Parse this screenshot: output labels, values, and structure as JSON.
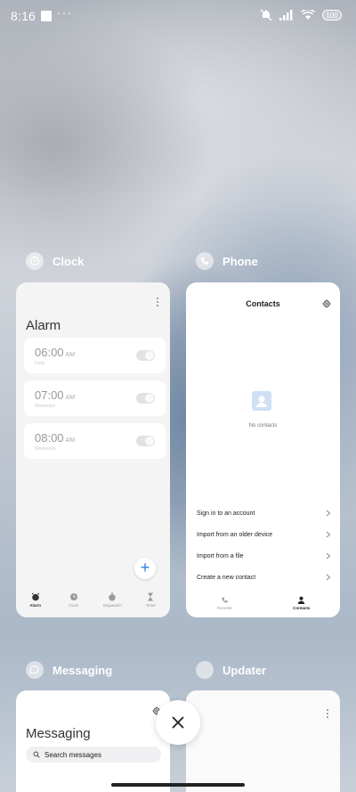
{
  "status_bar": {
    "time": "8:16",
    "dots": "···",
    "battery": "100"
  },
  "clock": {
    "app_name": "Clock",
    "screen_title": "Alarm",
    "alarms": [
      {
        "time": "06:00",
        "ampm": "AM",
        "subtitle": "Daily",
        "enabled": false
      },
      {
        "time": "07:00",
        "ampm": "AM",
        "subtitle": "Weekdays",
        "enabled": false
      },
      {
        "time": "08:00",
        "ampm": "AM",
        "subtitle": "Weekends",
        "enabled": false
      }
    ],
    "fab_label": "+",
    "nav": [
      {
        "label": "Alarm",
        "icon": "alarm-icon",
        "active": true
      },
      {
        "label": "Clock",
        "icon": "clock-icon",
        "active": false
      },
      {
        "label": "Stopwatch",
        "icon": "stopwatch-icon",
        "active": false
      },
      {
        "label": "Timer",
        "icon": "timer-icon",
        "active": false
      }
    ]
  },
  "phone": {
    "app_name": "Phone",
    "screen_title": "Contacts",
    "empty_text": "No contacts",
    "rows": [
      {
        "label": "Sign in to an account"
      },
      {
        "label": "Import from an older device"
      },
      {
        "label": "Import from a file"
      },
      {
        "label": "Create a new contact"
      }
    ],
    "nav": [
      {
        "label": "Recents",
        "icon": "phone-icon",
        "active": false
      },
      {
        "label": "Contacts",
        "icon": "person-icon",
        "active": true
      }
    ]
  },
  "messaging": {
    "app_name": "Messaging",
    "screen_title": "Messaging",
    "search_placeholder": "Search messages"
  },
  "updater": {
    "app_name": "Updater"
  },
  "colors": {
    "accent": "#2b7de0",
    "card_bg": "#f7f7f8"
  }
}
